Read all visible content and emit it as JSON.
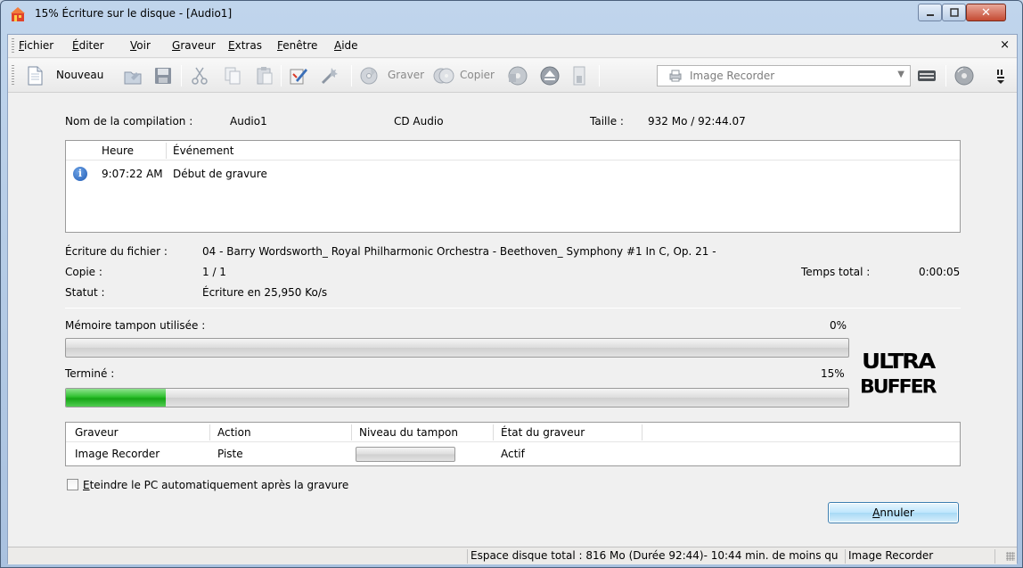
{
  "window": {
    "title": "15% Écriture sur le disque - [Audio1]"
  },
  "menu": {
    "items": [
      {
        "mnemonic": "F",
        "rest": "ichier"
      },
      {
        "mnemonic": "É",
        "rest": "diter"
      },
      {
        "mnemonic": "V",
        "rest": "oir"
      },
      {
        "mnemonic": "G",
        "rest": "raveur"
      },
      {
        "mnemonic": "E",
        "rest": "xtras"
      },
      {
        "mnemonic": "F",
        "rest": "enêtre"
      },
      {
        "mnemonic": "A",
        "rest": "ide"
      }
    ],
    "close": "×"
  },
  "toolbar": {
    "new_label": "Nouveau",
    "burn_label": "Graver",
    "copy_label": "Copier",
    "recorder": "Image Recorder",
    "icons": [
      "new-document-icon",
      "open-icon",
      "save-icon",
      "cut-icon",
      "copy-icon",
      "paste-icon",
      "edit-icon",
      "wizard-icon",
      "burn-icon",
      "copy-disc-icon",
      "disc-info-icon",
      "eject-icon",
      "recorder-icon",
      "drive-icon",
      "disc-icon"
    ]
  },
  "compilation": {
    "name_label": "Nom de la compilation :",
    "name_value": "Audio1",
    "type": "CD Audio",
    "size_label": "Taille :",
    "size_value": "932 Mo  /  92:44.07"
  },
  "events": {
    "columns": [
      "Heure",
      "Événement"
    ],
    "rows": [
      {
        "icon": "info-icon",
        "time": "9:07:22 AM",
        "event": "Début de gravure"
      }
    ]
  },
  "details": {
    "file_label": "Écriture du fichier :",
    "file_value": "04 - Barry Wordsworth_ Royal Philharmonic Orchestra - Beethoven_ Symphony #1 In C, Op. 21 -",
    "copy_label": "Copie :",
    "copy_value": "1 / 1",
    "total_time_label": "Temps total :",
    "total_time_value": "0:00:05",
    "status_label": "Statut :",
    "status_value": "Écriture en 25,950 Ko/s"
  },
  "buffer": {
    "label": "Mémoire tampon utilisée :",
    "percent_text": "0%",
    "fraction": 0.0
  },
  "done": {
    "label": "Terminé :",
    "percent_text": "15%",
    "fraction": 0.128
  },
  "logo": {
    "line1": "ULTRA",
    "line2": "BUFFER"
  },
  "burners": {
    "columns": [
      "Graveur",
      "Action",
      "Niveau du tampon",
      "État du graveur"
    ],
    "rows": [
      {
        "burner": "Image Recorder",
        "action": "Piste",
        "buffer_fraction": 0.0,
        "state": "Actif"
      }
    ]
  },
  "shutdown": {
    "mnemonic": "E",
    "rest": "teindre le PC automatiquement après la gravure",
    "checked": false
  },
  "cancel": {
    "mnemonic": "A",
    "rest": "nnuler"
  },
  "statusbar": {
    "disk_space": "Espace disque total : 816 Mo (Durée 92:44)- 10:44 min. de moins qu",
    "recorder": "Image Recorder"
  },
  "colors": {
    "progress_green": "#16a616",
    "window_frame": "#c0d5ec",
    "button_blue": "#bee6fd"
  }
}
